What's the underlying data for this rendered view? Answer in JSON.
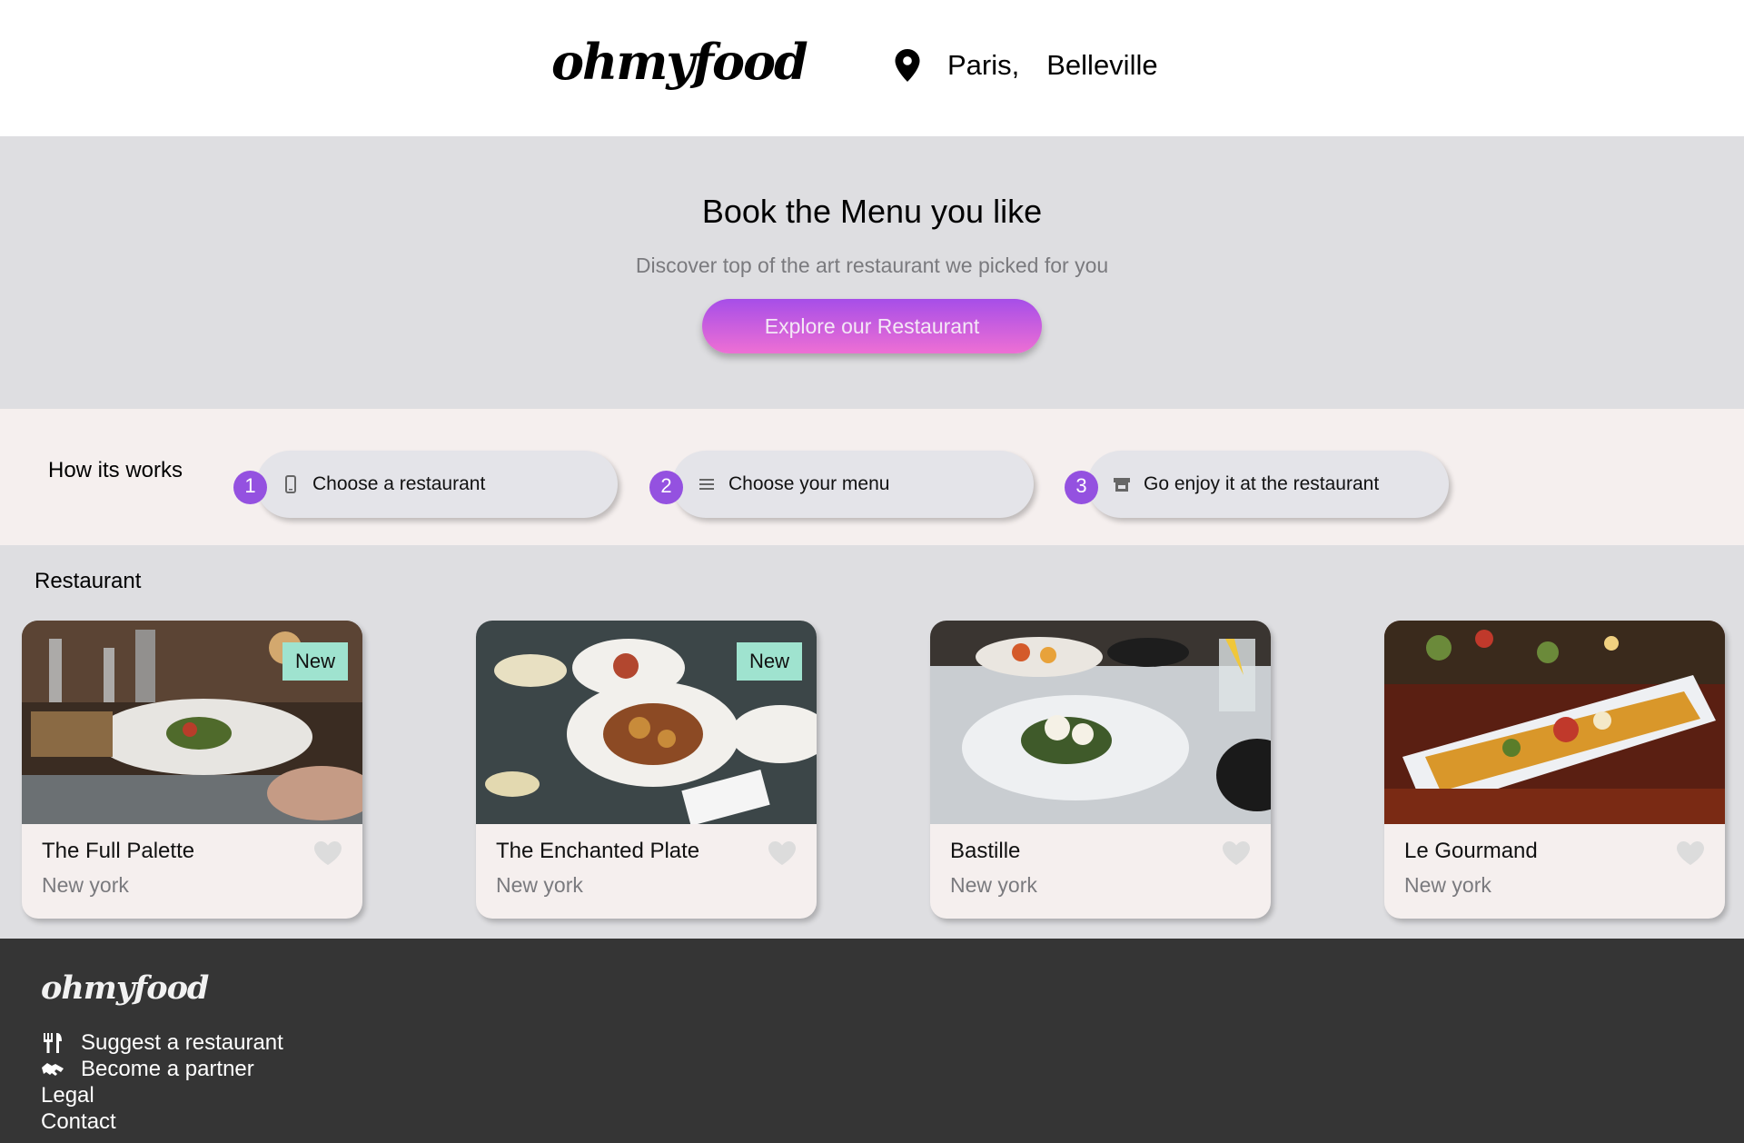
{
  "header": {
    "logo": "ohmyfood",
    "location_icon": "map-pin-icon",
    "city": "Paris,",
    "district": "Belleville"
  },
  "hero": {
    "title": "Book the Menu you like",
    "subtitle": "Discover top of the art restaurant we picked for you",
    "button_label": "Explore our Restaurant"
  },
  "how_it_works": {
    "title": "How its works",
    "steps": [
      {
        "number": "1",
        "icon": "mobile-phone-icon",
        "label": "Choose a restaurant"
      },
      {
        "number": "2",
        "icon": "menu-list-icon",
        "label": "Choose your menu"
      },
      {
        "number": "3",
        "icon": "store-icon",
        "label": "Go enjoy it at the restaurant"
      }
    ]
  },
  "restaurants": {
    "title": "Restaurant",
    "items": [
      {
        "name": "The Full Palette",
        "location": "New york",
        "badge": "New",
        "favorite_icon": "heart-icon"
      },
      {
        "name": "The Enchanted Plate",
        "location": "New york",
        "badge": "New",
        "favorite_icon": "heart-icon"
      },
      {
        "name": "Bastille",
        "location": "New york",
        "badge": "",
        "favorite_icon": "heart-icon"
      },
      {
        "name": "Le Gourmand",
        "location": "New york",
        "badge": "",
        "favorite_icon": "heart-icon"
      }
    ]
  },
  "footer": {
    "logo": "ohmyfood",
    "links": [
      {
        "icon": "utensils-icon",
        "label": "Suggest a restaurant"
      },
      {
        "icon": "handshake-icon",
        "label": "Become a partner"
      },
      {
        "icon": "",
        "label": "Legal"
      },
      {
        "icon": "",
        "label": "Contact"
      }
    ]
  },
  "colors": {
    "accent_purple": "#9451e0",
    "button_gradient_top": "#a64ee8",
    "button_gradient_bottom": "#ee6fd4",
    "badge_green": "#9fe3cf",
    "footer_bg": "#353535",
    "section_gray": "#dedee1",
    "section_cream": "#f5efee"
  }
}
